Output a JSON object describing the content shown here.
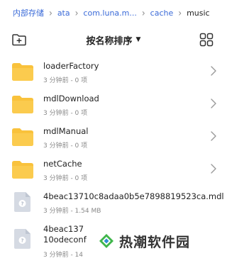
{
  "breadcrumb": {
    "items": [
      "内部存储",
      "ata",
      "com.luna.m...",
      "cache",
      "music"
    ]
  },
  "toolbar": {
    "sort_label": "按名称排序",
    "sort_caret": "▼",
    "new_folder_icon": "new-folder-icon",
    "view_toggle_icon": "grid-view-icon"
  },
  "files": [
    {
      "name": "loaderFactory",
      "meta": "3 分钟前 - 0 项",
      "type": "folder"
    },
    {
      "name": "mdlDownload",
      "meta": "3 分钟前 - 0 项",
      "type": "folder"
    },
    {
      "name": "mdlManual",
      "meta": "3 分钟前 - 0 项",
      "type": "folder"
    },
    {
      "name": "netCache",
      "meta": "3 分钟前 - 0 项",
      "type": "folder"
    },
    {
      "name": "4beac13710c8adaa0b5e7898819523ca.mdl",
      "meta": "3 分钟前 - 1.54 MB",
      "type": "file"
    },
    {
      "name": "4beac13710odeconf",
      "meta": "3 分钟前 - 14",
      "type": "file"
    }
  ],
  "watermark": {
    "text": "热潮软件园"
  },
  "colors": {
    "accent": "#3a6ad8",
    "folder": "#f9c23c",
    "file_icon": "#d5dae3"
  }
}
